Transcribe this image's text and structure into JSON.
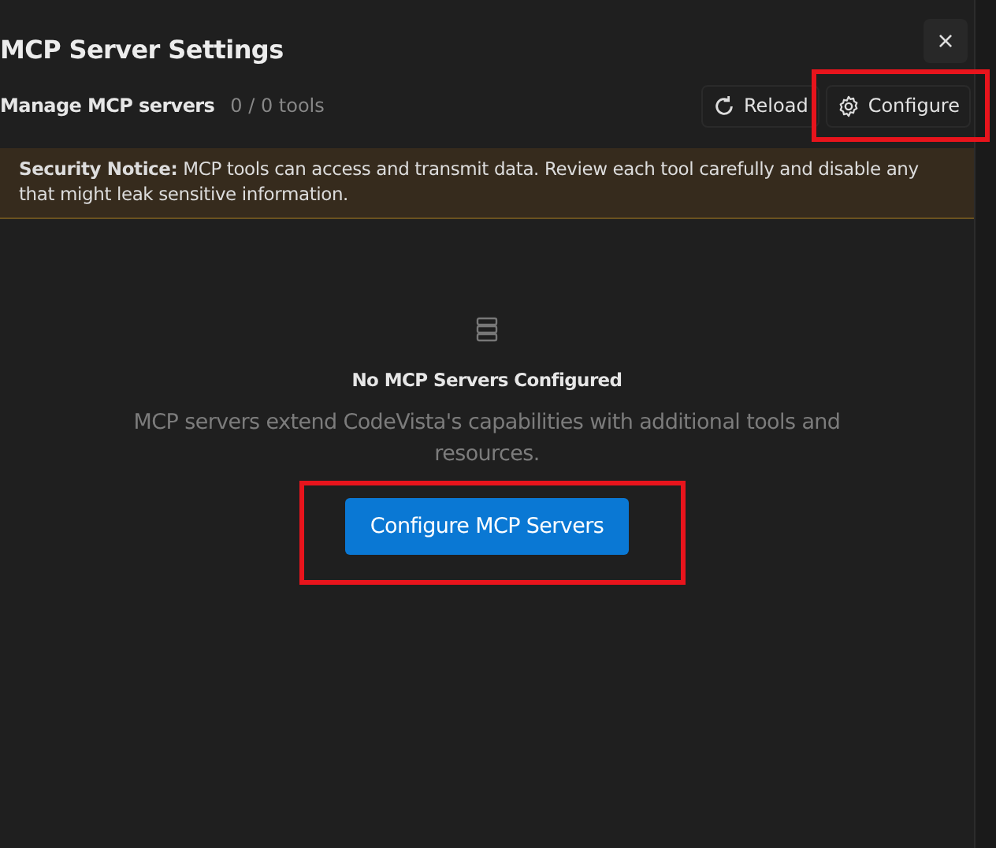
{
  "dialog": {
    "title": "MCP Server Settings",
    "close": "×"
  },
  "toolbar": {
    "label": "Manage MCP servers",
    "count": "0 / 0 tools",
    "buttons": [
      {
        "kind": "reload",
        "label": "Reload",
        "highlighted": false
      },
      {
        "kind": "configure",
        "label": "Configure",
        "highlighted": true
      }
    ]
  },
  "notice": {
    "text": "**Security Notice:** MCP tools can access and transmit data. Review each tool carefully and disable any that might leak sensitive information."
  },
  "empty_state": {
    "title": "No MCP Servers Configured",
    "description": "MCP servers extend CodeVista's capabilities with additional tools and resources.",
    "button": {
      "label": "Configure MCP Servers",
      "highlighted": true
    }
  }
}
